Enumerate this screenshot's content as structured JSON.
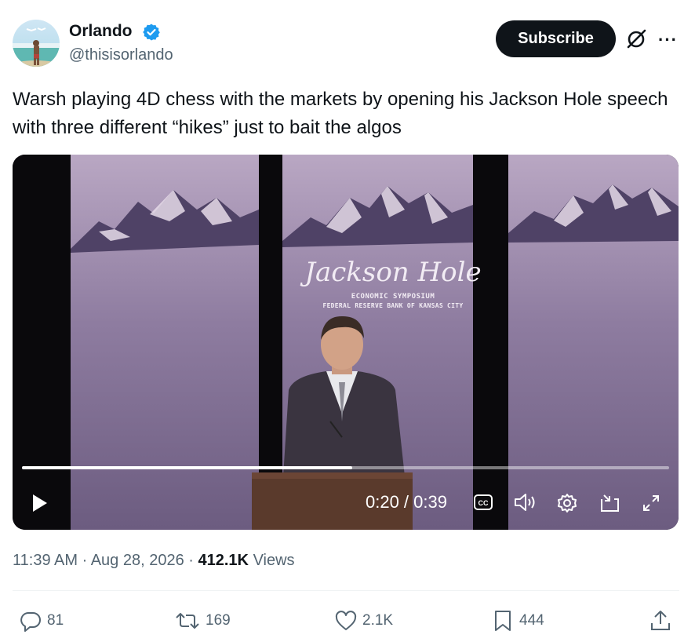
{
  "author": {
    "name": "Orlando",
    "handle": "@thisisorlando",
    "verified": true,
    "badge_color": "#1d9bf0"
  },
  "header": {
    "subscribe_label": "Subscribe",
    "icons": [
      "grok-icon",
      "more-icon"
    ]
  },
  "tweet": {
    "text": "Warsh playing 4D chess with the markets by opening his Jackson Hole speech with three different “hikes” just to bait the algos"
  },
  "video": {
    "backdrop_title": "Jackson Hole",
    "backdrop_subtitle_1": "ECONOMIC SYMPOSIUM",
    "backdrop_subtitle_2": "FEDERAL RESERVE BANK OF KANSAS CITY",
    "current_time": "0:20",
    "duration": "0:39",
    "time_display": "0:20 / 0:39",
    "progress_fraction": 0.51,
    "controls": [
      "play-icon",
      "captions-icon",
      "volume-icon",
      "settings-icon",
      "picture-in-picture-icon",
      "fullscreen-icon"
    ]
  },
  "meta": {
    "time": "11:39 AM",
    "date": "Aug 28, 2026",
    "views_count": "412.1K",
    "views_label": "Views"
  },
  "actions": {
    "replies": "81",
    "reposts": "169",
    "likes": "2.1K",
    "bookmarks": "444"
  }
}
